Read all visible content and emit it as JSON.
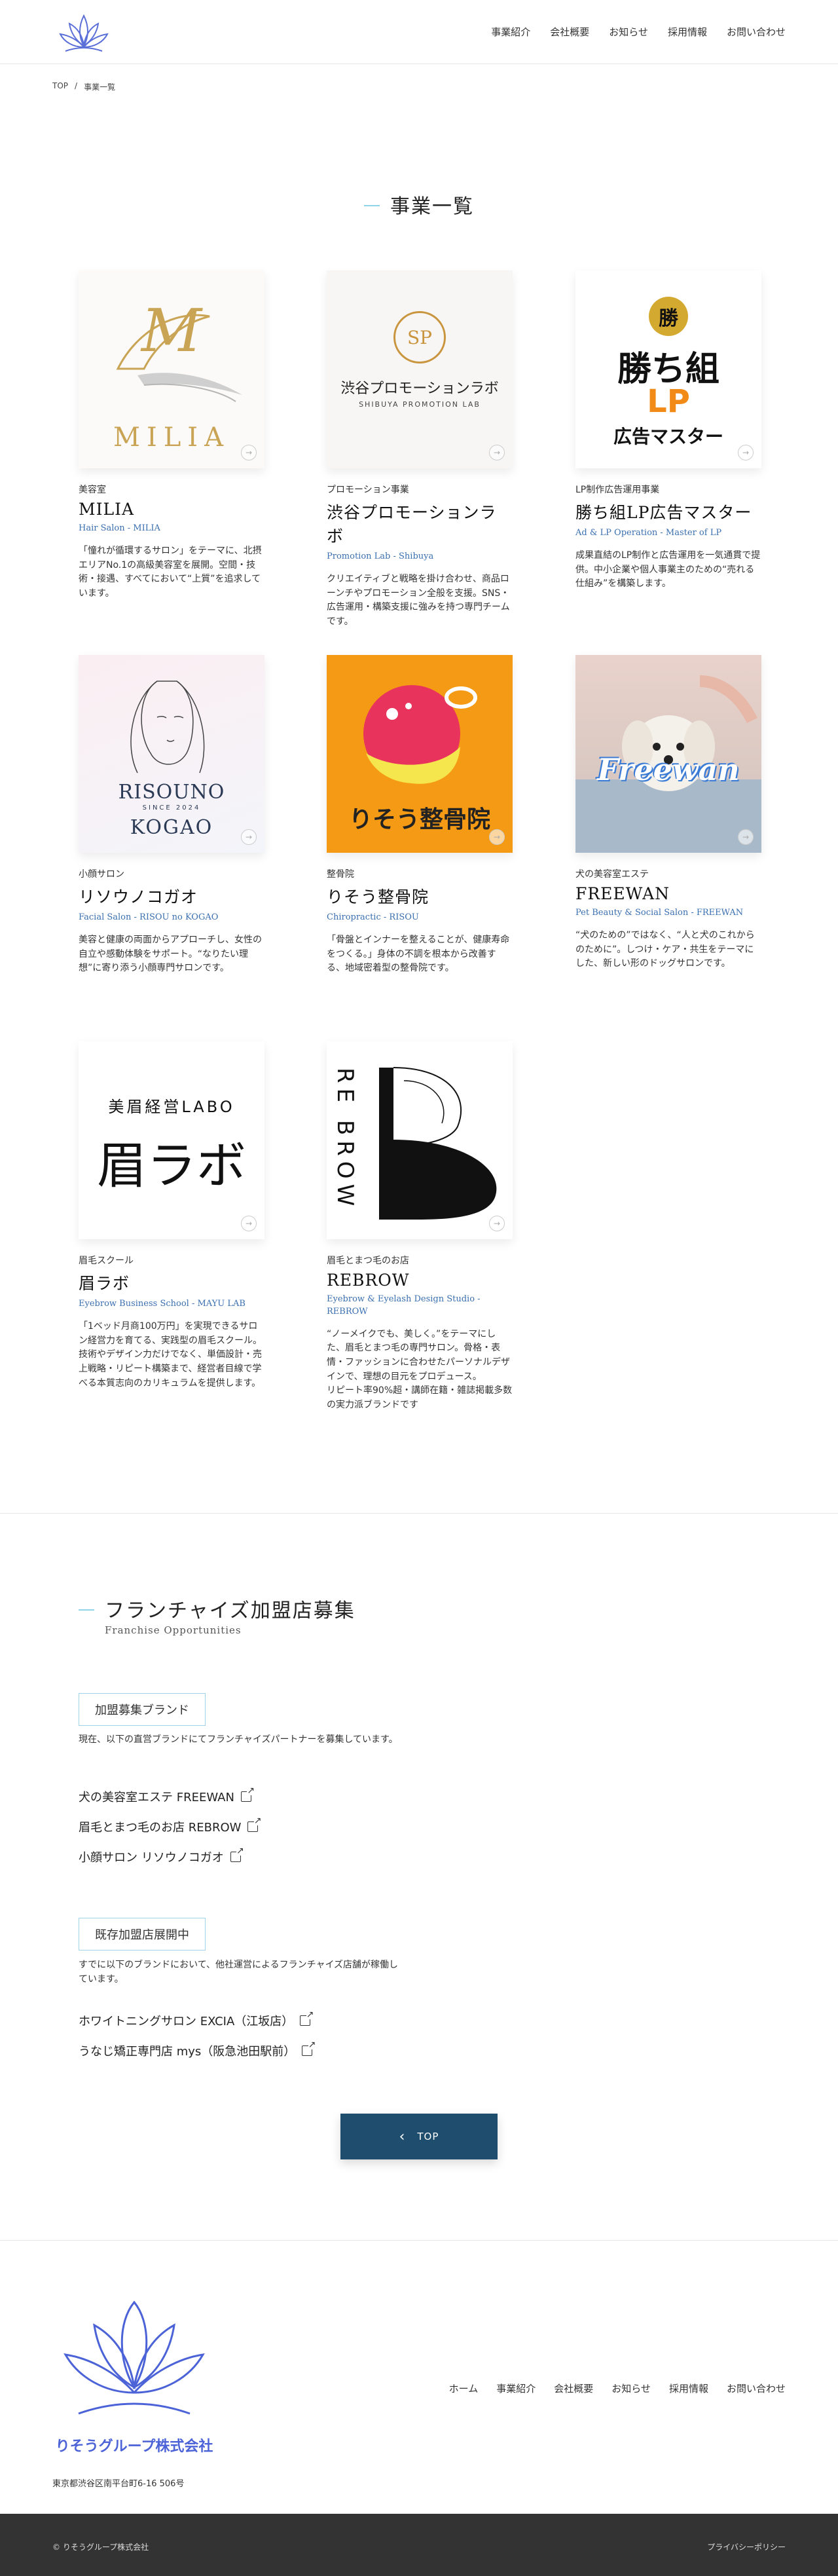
{
  "header": {
    "nav": [
      "事業紹介",
      "会社概要",
      "お知らせ",
      "採用情報",
      "お問い合わせ"
    ]
  },
  "breadcrumb": {
    "home": "TOP",
    "sep": "/",
    "current": "事業一覧"
  },
  "section_title": "事業一覧",
  "cards": [
    {
      "cat": "美容室",
      "name": "MILIA",
      "en": "Hair Salon - MILIA",
      "desc": "「憧れが循環するサロン」をテーマに、北摂エリアNo.1の高級美容室を展開。空間・技術・接遇、すべてにおいて“上質”を追求しています。",
      "logo_text": "MILIA",
      "monogram": "M"
    },
    {
      "cat": "プロモーション事業",
      "name": "渋谷プロモーションラボ",
      "en": "Promotion Lab - Shibuya",
      "desc": "クリエイティブと戦略を掛け合わせ、商品ローンチやプロモーション全般を支援。SNS・広告運用・構築支援に強みを持つ専門チームです。",
      "logo_text": "渋谷プロモーションラボ",
      "logo_sub": "SHIBUYA PROMOTION LAB",
      "monogram": "SP"
    },
    {
      "cat": "LP制作広告運用事業",
      "name": "勝ち組LP広告マスター",
      "en": "Ad & LP Operation - Master of LP",
      "desc": "成果直結のLP制作と広告運用を一気通貫で提供。中小企業や個人事業主のための“売れる仕組み”を構築します。",
      "logo_line1": "勝ち組",
      "logo_line2": "LP",
      "logo_line3": "広告マスター",
      "badge": "勝"
    },
    {
      "cat": "小顔サロン",
      "name": "リソウノコガオ",
      "en": "Facial Salon - RISOU no KOGAO",
      "desc": "美容と健康の両面からアプローチし、女性の自立や感動体験をサポート。“なりたい理想”に寄り添う小顔専門サロンです。",
      "logo_line1": "RISOUNO",
      "logo_line2": "SINCE 2024",
      "logo_line3": "KOGAO"
    },
    {
      "cat": "整骨院",
      "name": "りそう整骨院",
      "en": "Chiropractic - RISOU",
      "desc": "「骨盤とインナーを整えることが、健康寿命をつくる。」身体の不調を根本から改善する、地域密着型の整骨院です。",
      "logo_text": "りそう整骨院"
    },
    {
      "cat": "犬の美容室エステ",
      "name": "FREEWAN",
      "en": "Pet Beauty & Social Salon - FREEWAN",
      "desc": "“犬のための”ではなく、“人と犬のこれからのために”。しつけ・ケア・共生をテーマにした、新しい形のドッグサロンです。",
      "logo_text": "Freewan"
    },
    {
      "cat": "眉毛スクール",
      "name": "眉ラボ",
      "en": "Eyebrow Business School - MAYU LAB",
      "desc": "「1ベッド月商100万円」を実現できるサロン経営力を育てる、実践型の眉毛スクール。\n技術やデザイン力だけでなく、単価設計・売上戦略・リピート構築まで、経営者目線で学べる本質志向のカリキュラムを提供します。",
      "logo_line1": "美眉経営LABO",
      "logo_line2": "眉ラボ"
    },
    {
      "cat": "眉毛とまつ毛のお店",
      "name": "REBROW",
      "en": "Eyebrow & Eyelash Design Studio - REBROW",
      "desc": "“ノーメイクでも、美しく。”をテーマにした、眉毛とまつ毛の専門サロン。骨格・表情・ファッションに合わせたパーソナルデザインで、理想の目元をプロデュース。\nリピート率90%超・講師在籍・雑誌掲載多数の実力派ブランドです",
      "logo_text": "RE BROW"
    }
  ],
  "franchise": {
    "title": "フランチャイズ加盟店募集",
    "subtitle": "Franchise Opportunities",
    "recruit_tag": "加盟募集ブランド",
    "recruit_note": "現在、以下の直営ブランドにてフランチャイズパートナーを募集しています。",
    "recruit_links": [
      "犬の美容室エステ FREEWAN",
      "眉毛とまつ毛のお店 REBROW",
      "小顔サロン リソウノコガオ"
    ],
    "existing_tag": "既存加盟店展開中",
    "existing_note": "すでに以下のブランドにおいて、他社運営によるフランチャイズ店舗が稼働しています。",
    "existing_links": [
      "ホワイトニングサロン EXCIA（江坂店）",
      "うなじ矯正専門店 mys（阪急池田駅前）"
    ]
  },
  "top_button": {
    "arrow": "‹",
    "label": "TOP"
  },
  "footer": {
    "company": "りそうグループ株式会社",
    "nav": [
      "ホーム",
      "事業紹介",
      "会社概要",
      "お知らせ",
      "採用情報",
      "お問い合わせ"
    ],
    "address": "東京都渋谷区南平台町6-16 506号",
    "copyright": "© りそうグループ株式会社",
    "privacy": "プライバシーポリシー"
  }
}
